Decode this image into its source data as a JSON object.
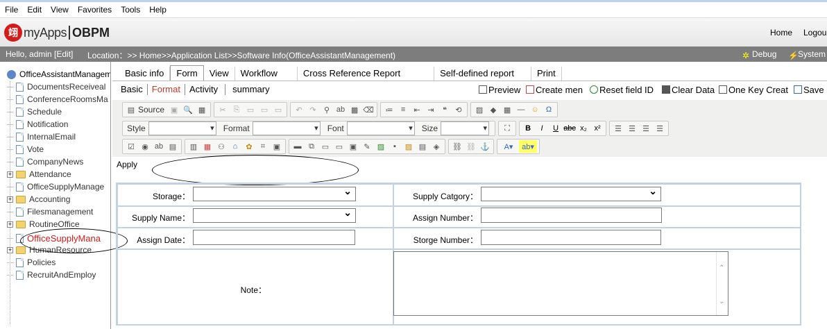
{
  "menu": [
    "File",
    "Edit",
    "View",
    "Favorites",
    "Tools",
    "Help"
  ],
  "header": {
    "brand": "myApps",
    "product": "OBPM",
    "home": "Home",
    "logout": "Logou"
  },
  "status": {
    "greeting": "Hello, admin [Edit]",
    "location": "Location：>> Home>>Application List>>Software Info(OfficeAssistantManagement)",
    "debug": "Debug",
    "system": "System"
  },
  "sidebar": {
    "root": "OfficeAssistantManagem",
    "items": [
      {
        "label": "DocumentsReceiveal",
        "type": "doc"
      },
      {
        "label": "ConferenceRoomsMa",
        "type": "doc"
      },
      {
        "label": "Schedule",
        "type": "doc"
      },
      {
        "label": "Notification",
        "type": "doc"
      },
      {
        "label": "InternalEmail",
        "type": "doc"
      },
      {
        "label": "Vote",
        "type": "doc"
      },
      {
        "label": "CompanyNews",
        "type": "doc"
      },
      {
        "label": "Attendance",
        "type": "folder"
      },
      {
        "label": "OfficeSupplyManage",
        "type": "doc"
      },
      {
        "label": "Accounting",
        "type": "folder"
      },
      {
        "label": "Filesmanagement",
        "type": "doc"
      },
      {
        "label": "RoutineOffice",
        "type": "folder"
      },
      {
        "label": "OfficeSupplyMana",
        "type": "doc-active"
      },
      {
        "label": "HumanResource",
        "type": "folder"
      },
      {
        "label": "Policies",
        "type": "doc"
      },
      {
        "label": "RecruitAndEmploy",
        "type": "doc"
      }
    ]
  },
  "tabs1": [
    "Basic info",
    "Form",
    "View",
    "Workflow",
    "Cross Reference Report",
    "Self-defined report",
    "Print"
  ],
  "tabs2": [
    "Basic",
    "Format",
    "Activity",
    "summary"
  ],
  "actions": [
    "Preview",
    "Create men",
    "Reset field ID",
    "Clear Data",
    "One Key Creat",
    "Save"
  ],
  "toolbar": {
    "source": "Source",
    "style": "Style",
    "format": "Format",
    "font": "Font",
    "size": "Size"
  },
  "form": {
    "apply": "Apply",
    "storage": "Storage：",
    "supply_category": "Supply Catgory：",
    "supply_name": "Supply Name：",
    "assign_number": "Assign Number：",
    "assign_date": "Assign Date：",
    "storge_number": "Storge Number：",
    "note": "Note："
  }
}
